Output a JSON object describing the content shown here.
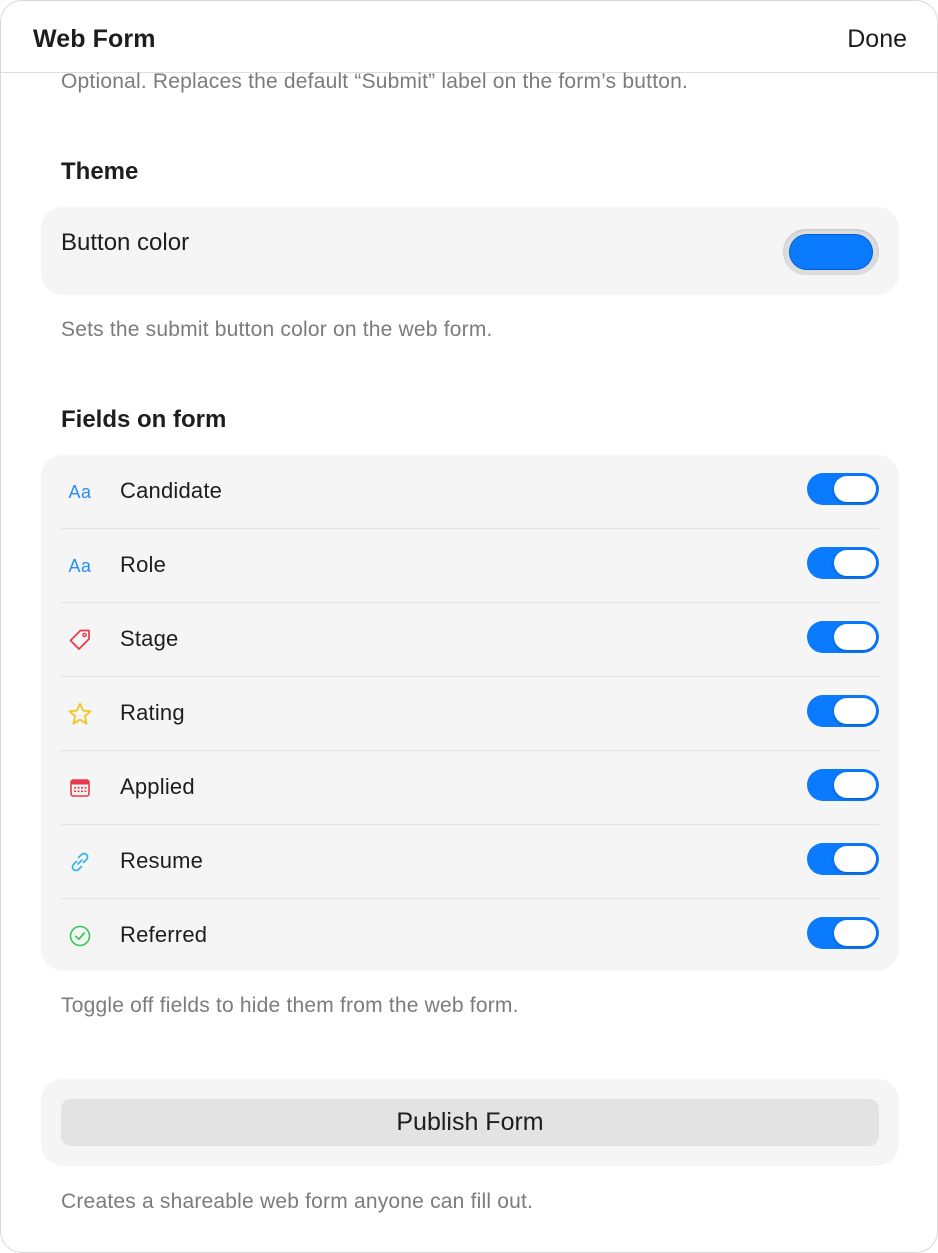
{
  "window": {
    "title": "Web Form",
    "done_label": "Done"
  },
  "top_caption": "Optional. Replaces the default “Submit” label on the form’s button.",
  "theme": {
    "title": "Theme",
    "button_color_label": "Button color",
    "button_color_value": "#0a7aff",
    "caption": "Sets the submit button color on the web form."
  },
  "fields": {
    "title": "Fields on form",
    "items": [
      {
        "label": "Candidate",
        "icon": "text-aa-icon",
        "icon_text": "Aa",
        "enabled": true
      },
      {
        "label": "Role",
        "icon": "text-aa-icon",
        "icon_text": "Aa",
        "enabled": true
      },
      {
        "label": "Stage",
        "icon": "tag-icon",
        "enabled": true
      },
      {
        "label": "Rating",
        "icon": "star-icon",
        "enabled": true
      },
      {
        "label": "Applied",
        "icon": "calendar-icon",
        "enabled": true
      },
      {
        "label": "Resume",
        "icon": "link-icon",
        "enabled": true
      },
      {
        "label": "Referred",
        "icon": "checkmark-circle-icon",
        "enabled": true
      }
    ],
    "caption": "Toggle off fields to hide them from the web form."
  },
  "publish": {
    "button_label": "Publish Form",
    "caption": "Creates a shareable web form anyone can fill out."
  },
  "colors": {
    "accent": "#0a7aff",
    "tag": "#e8394a",
    "star": "#f2c417",
    "calendar": "#e8394a",
    "link": "#35b6e8",
    "check": "#34c759"
  }
}
